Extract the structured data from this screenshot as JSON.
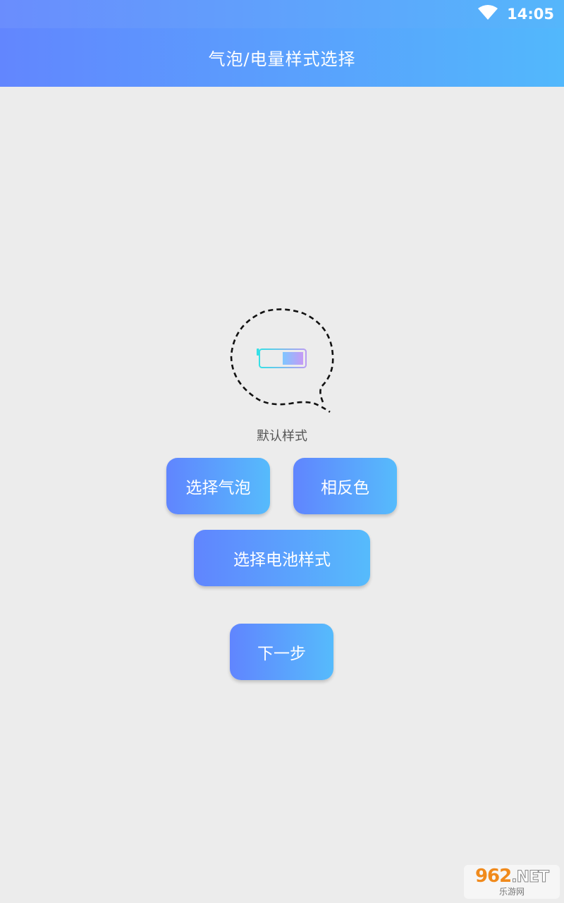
{
  "status": {
    "time": "14:05",
    "wifi_icon": "wifi-icon"
  },
  "header": {
    "title": "气泡/电量样式选择"
  },
  "preview": {
    "label": "默认样式",
    "battery_level": 0.5
  },
  "buttons": {
    "select_bubble": "选择气泡",
    "invert_color": "相反色",
    "select_battery": "选择电池样式",
    "next": "下一步"
  },
  "watermark": {
    "main": "962",
    "suffix": ".NET",
    "sub": "乐游网"
  },
  "colors": {
    "gradient_start": "#6085fe",
    "gradient_end": "#56bbfc",
    "background": "#ececec"
  }
}
